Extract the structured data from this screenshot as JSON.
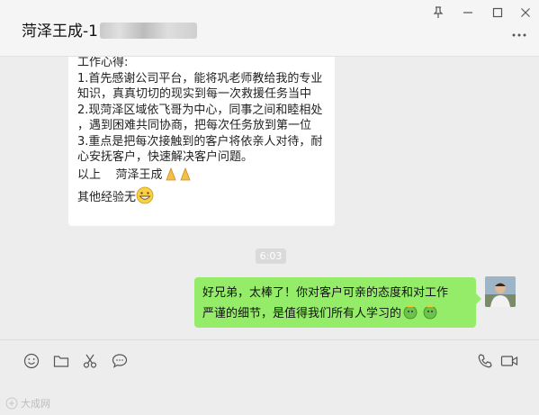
{
  "window": {
    "title": "菏泽王成-1",
    "controls": {
      "pin": "pin-icon",
      "minimize": "minimize-icon",
      "maximize": "maximize-icon",
      "close": "close-icon"
    },
    "more": "more-icon"
  },
  "messages": {
    "incoming": {
      "lines": [
        "工作心得:",
        "1.首先感谢公司平台，能将巩老师教给我的专业",
        "知识，真真切切的现实到每一次救援任务当中",
        "2.现菏泽区域依飞哥为中心，同事之间和睦相处",
        "，遇到困难共同协商，把每次任务放到第一位",
        "3.重点是把每次接触到的客户将依亲人对待，耐",
        "心安抚客户，快速解决客户问题。",
        "以上    菏泽王成",
        "其他经验无"
      ]
    },
    "timestamp": "6:03",
    "outgoing": {
      "lines": [
        "好兄弟，太棒了！你对客户可亲的态度和对工作",
        "严谨的细节，是值得我们所有人学习的"
      ]
    }
  },
  "toolbar": {
    "left": [
      "emoji-icon",
      "folder-icon",
      "scissors-icon",
      "chat-bubble-icon"
    ],
    "right": [
      "phone-icon",
      "video-icon"
    ]
  },
  "watermark": "大成网"
}
